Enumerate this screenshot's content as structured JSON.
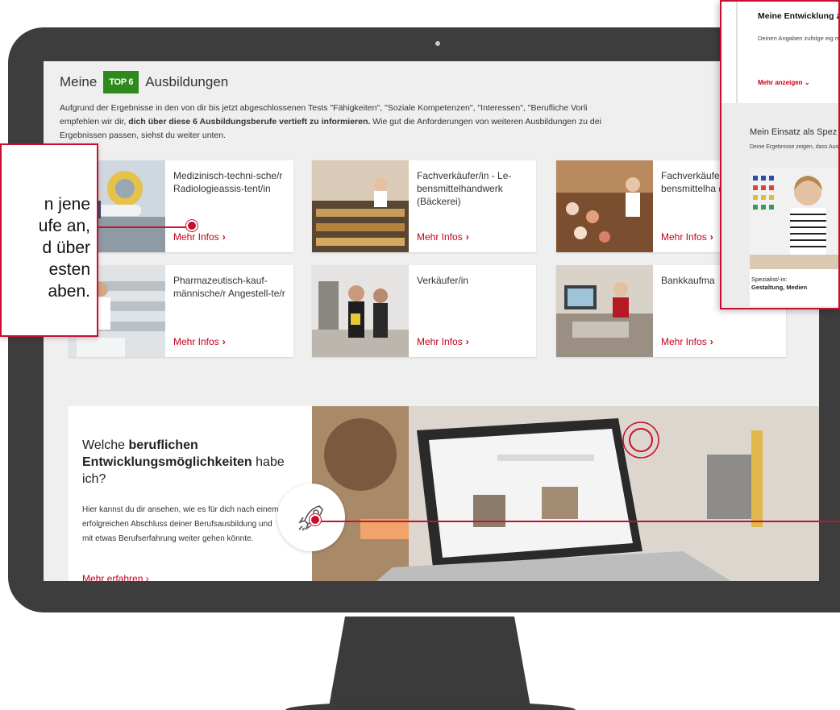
{
  "header": {
    "prefix": "Meine",
    "badge": "TOP 6",
    "suffix": "Ausbildungen"
  },
  "intro": {
    "line1": "Aufgrund der Ergebnisse in den von dir bis jetzt abgeschlossenen Tests \"Fähigkeiten\", \"Soziale Kompetenzen\", \"Interessen\", \"Berufliche Vorli",
    "line2_plain": "empfehlen wir dir, ",
    "line2_bold": "dich über diese 6 Ausbildungsberufe vertieft zu informieren.",
    "line2_rest": " Wie gut die Anforderungen von weiteren Ausbildungen zu dei",
    "line3": "Ergebnissen passen, siehst du weiter unten."
  },
  "cards": [
    {
      "title": "Medizinisch-techni-sche/r Radiologieassis-tent/in",
      "more": "Mehr Infos"
    },
    {
      "title": "Fachverkäufer/in - Le-bensmittelhandwerk (Bäckerei)",
      "more": "Mehr Infos"
    },
    {
      "title": "Fachverkäufe bensmittelha (Konditorei)",
      "more": "Mehr Infos"
    },
    {
      "title": "Pharmazeutisch-kauf-männische/r Angestell-te/r",
      "more": "Mehr Infos"
    },
    {
      "title": "Verkäufer/in",
      "more": "Mehr Infos"
    },
    {
      "title": "Bankkaufma",
      "more": "Mehr Infos"
    }
  ],
  "promo": {
    "heading_plain1": "Welche ",
    "heading_bold": "beruflichen Entwicklungsmöglichkeiten",
    "heading_plain2": " habe ich?",
    "text": "Hier kannst du dir ansehen, wie es für dich nach einem erfolgreichen Abschluss deiner Berufsausbildung und mit etwas Berufserfahrung weiter gehen könnte.",
    "more": "Mehr erfahren"
  },
  "callout_left": {
    "lines": [
      "n jene",
      "ufe an,",
      "d über",
      "esten",
      "aben."
    ]
  },
  "panel": {
    "title": "Meine Entwicklung zu Führungskraft",
    "text": "Deinen Angaben zufolge eig möglicherweise gut für Führ",
    "more": "Mehr anzeigen",
    "heading": "Mein Einsatz als Spez",
    "text2": "Deine Ergebnisse zeigen, dass Ausbildungen näher informiers",
    "caption_label": "Spezialist/-in:",
    "caption_value": "Gestaltung, Medien"
  },
  "colors": {
    "accent": "#c8102e",
    "badge": "#2f8a1e",
    "monitor": "#3d3d3d"
  }
}
